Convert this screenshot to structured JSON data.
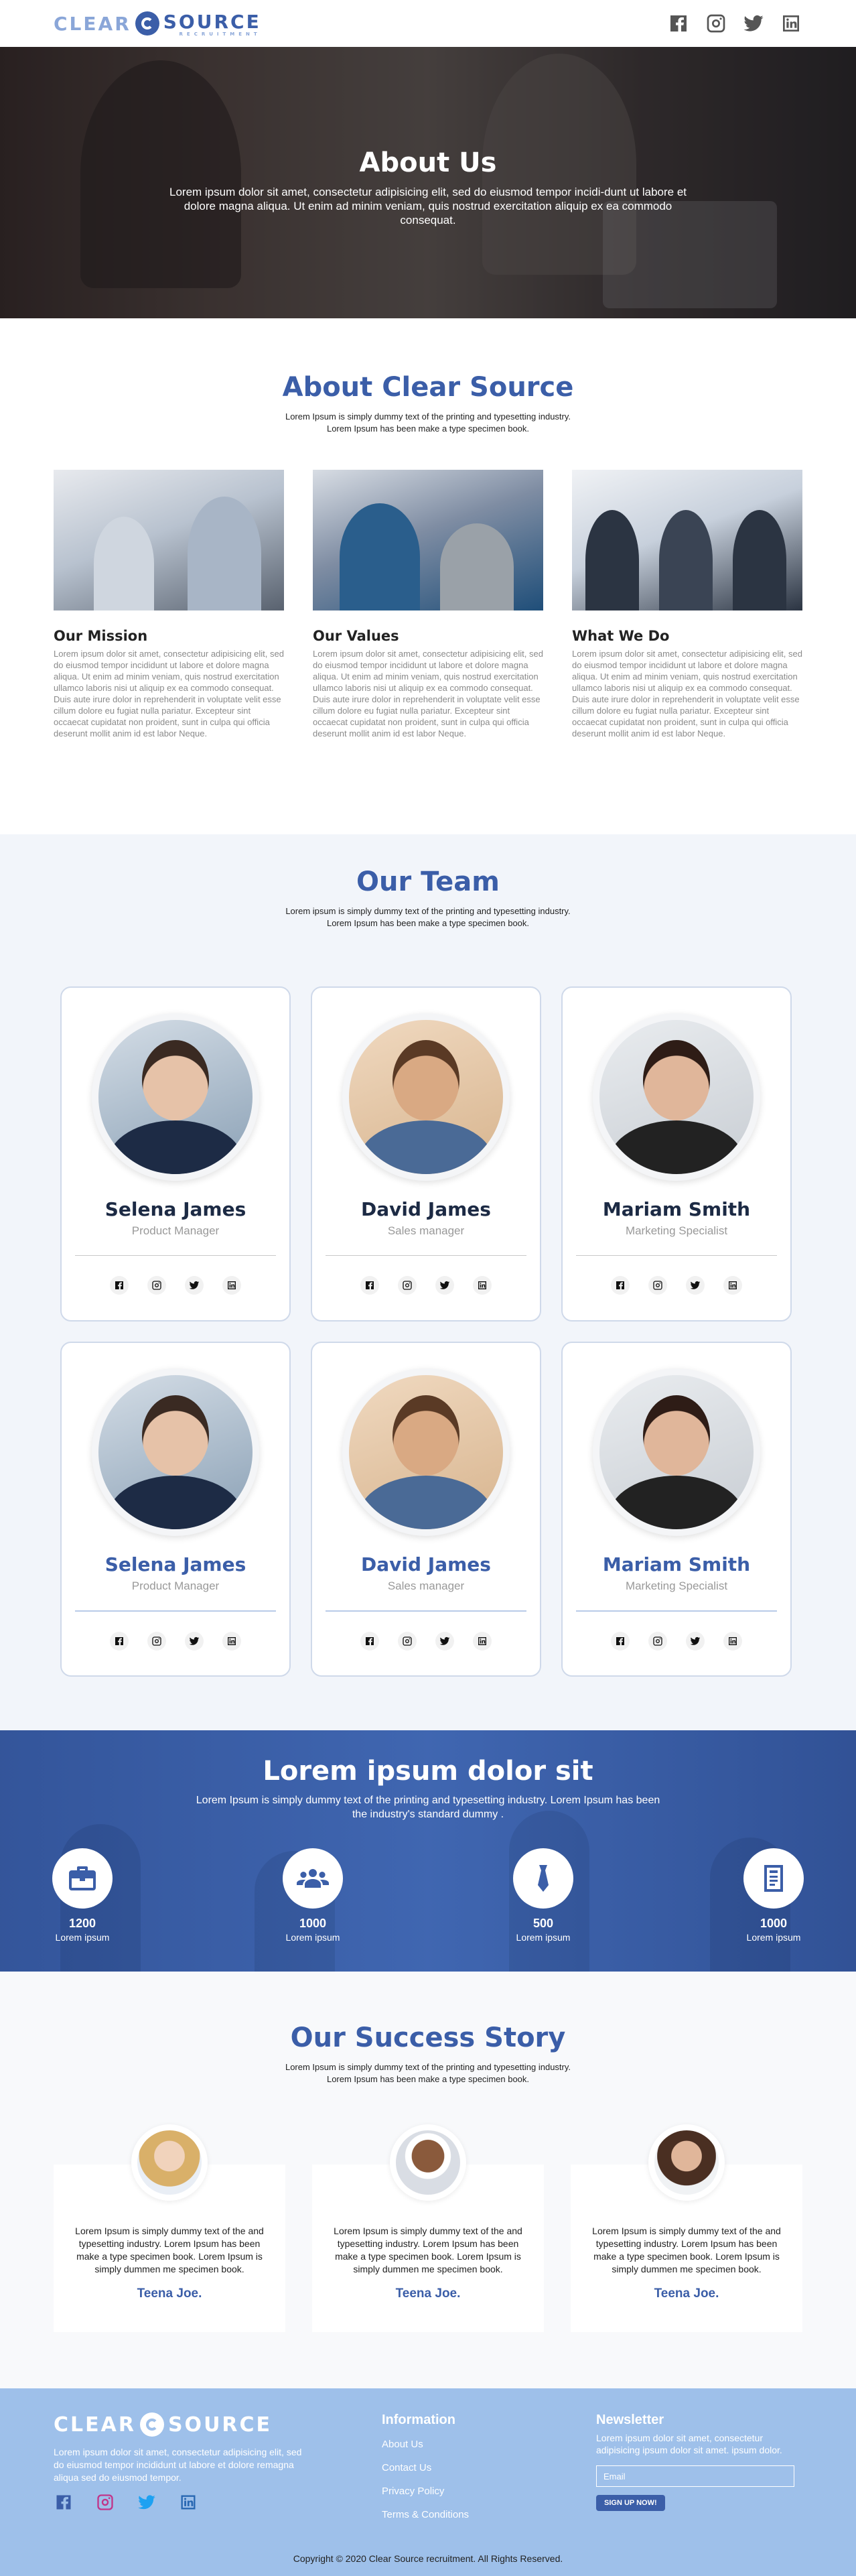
{
  "header": {
    "logo_word1": "CLEAR",
    "logo_word2": "SOURCE",
    "logo_tagline": "RECRUITMENT",
    "social_icons": [
      "facebook-icon",
      "instagram-icon",
      "twitter-icon",
      "linkedin-icon"
    ]
  },
  "hero": {
    "title": "About Us",
    "text": "Lorem ipsum dolor sit amet, consectetur adipisicing elit, sed do eiusmod tempor incidi-dunt ut labore et dolore magna aliqua. Ut enim ad minim veniam, quis nostrud exercitation aliquip ex ea commodo consequat."
  },
  "about": {
    "title": "About Clear Source",
    "subtitle": "Lorem Ipsum is simply dummy text of the printing and typesetting industry. Lorem Ipsum has been make a type specimen book.",
    "columns": [
      {
        "heading": "Our Mission",
        "text": "Lorem ipsum dolor sit amet, consectetur adipisicing elit, sed do eiusmod tempor incididunt ut labore et dolore magna aliqua. Ut enim ad minim veniam, quis nostrud exercitation ullamco laboris nisi ut aliquip ex ea commodo consequat. Duis aute irure dolor in reprehenderit in voluptate velit esse cillum dolore eu fugiat nulla pariatur. Excepteur sint occaecat cupidatat non proident, sunt in culpa qui officia deserunt mollit anim id est labor Neque."
      },
      {
        "heading": "Our Values",
        "text": "Lorem ipsum dolor sit amet, consectetur adipisicing elit, sed do eiusmod tempor incididunt ut labore et dolore magna aliqua. Ut enim ad minim veniam, quis nostrud exercitation ullamco laboris nisi ut aliquip ex ea commodo consequat. Duis aute irure dolor in reprehenderit in voluptate velit esse cillum dolore eu fugiat nulla pariatur. Excepteur sint occaecat cupidatat non proident, sunt in culpa qui officia deserunt mollit anim id est labor Neque."
      },
      {
        "heading": "What We Do",
        "text": "Lorem ipsum dolor sit amet, consectetur adipisicing elit, sed do eiusmod tempor incididunt ut labore et dolore magna aliqua. Ut enim ad minim veniam, quis nostrud exercitation ullamco laboris nisi ut aliquip ex ea commodo consequat. Duis aute irure dolor in reprehenderit in voluptate velit esse cillum dolore eu fugiat nulla pariatur. Excepteur sint occaecat cupidatat non proident, sunt in culpa qui officia deserunt mollit anim id est labor Neque."
      }
    ]
  },
  "team": {
    "title": "Our Team",
    "subtitle": "Lorem ipsum is simply dummy text of the printing and typesetting industry. Lorem Ipsum has been make a type specimen book.",
    "members": [
      {
        "name": "Selena James",
        "role": "Product Manager"
      },
      {
        "name": "David James",
        "role": "Sales manager"
      },
      {
        "name": "Mariam Smith",
        "role": "Marketing Specialist"
      },
      {
        "name": "Selena James",
        "role": "Product Manager"
      },
      {
        "name": "David James",
        "role": "Sales manager"
      },
      {
        "name": "Mariam Smith",
        "role": "Marketing Specialist"
      }
    ],
    "member_social_icons": [
      "facebook-icon",
      "instagram-icon",
      "twitter-icon",
      "linkedin-icon"
    ]
  },
  "stats": {
    "title": "Lorem ipsum dolor sit",
    "text": "Lorem Ipsum is simply dummy text of the printing and typesetting industry. Lorem Ipsum has been the industry's standard dummy .",
    "items": [
      {
        "icon": "briefcase-icon",
        "value": "1200",
        "label": "Lorem ipsum"
      },
      {
        "icon": "group-icon",
        "value": "1000",
        "label": "Lorem ipsum"
      },
      {
        "icon": "tie-icon",
        "value": "500",
        "label": "Lorem ipsum"
      },
      {
        "icon": "resume-icon",
        "value": "1000",
        "label": "Lorem ipsum"
      }
    ]
  },
  "success": {
    "title": "Our Success Story",
    "subtitle": "Lorem Ipsum is simply dummy text of the printing and typesetting industry. Lorem Ipsum has been make a type specimen book.",
    "stories": [
      {
        "text": "Lorem Ipsum is simply dummy text of the and typesetting industry. Lorem Ipsum has been make a type specimen book. Lorem Ipsum is simply dummen me specimen book.",
        "name": "Teena Joe."
      },
      {
        "text": "Lorem Ipsum is simply dummy text of the and typesetting industry. Lorem Ipsum has been make a type specimen book. Lorem Ipsum is simply dummen me specimen book.",
        "name": "Teena Joe."
      },
      {
        "text": "Lorem Ipsum is simply dummy text of the and typesetting industry. Lorem Ipsum has been make a type specimen book. Lorem Ipsum is simply dummen me specimen book.",
        "name": "Teena Joe."
      }
    ]
  },
  "footer": {
    "logo_word1": "CLEAR",
    "logo_word2": "SOURCE",
    "description": "Lorem ipsum dolor sit amet, consectetur adipisicing elit, sed do eiusmod tempor incididunt ut labore et dolore remagna aliqua sed do eiusmod tempor.",
    "info_heading": "Information",
    "links": [
      "About Us",
      "Contact Us",
      "Privacy Policy",
      "Terms & Conditions"
    ],
    "newsletter_heading": "Newsletter",
    "newsletter_text": "Lorem ipsum dolor sit amet, consectetur adipisicing ipsum dolor sit amet. ipsum dolor.",
    "email_placeholder": "Email",
    "subscribe_label": "SIGN UP NOW!",
    "copyright": "Copyright © 2020 Clear Source recruitment. All Rights Reserved."
  }
}
